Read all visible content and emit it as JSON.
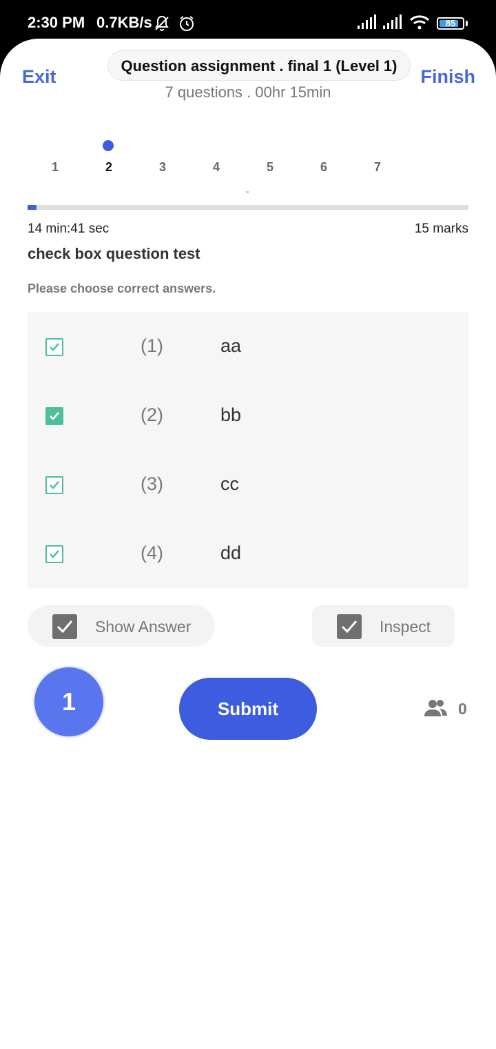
{
  "status_bar": {
    "time": "2:30 PM",
    "net_speed": "0.7KB/s",
    "battery_level": "85",
    "battery_fraction": 0.85,
    "icons": [
      "bell-muted-icon",
      "alarm-icon",
      "signal-icon",
      "signal-icon",
      "wifi-icon",
      "battery-icon"
    ]
  },
  "header": {
    "exit_label": "Exit",
    "finish_label": "Finish",
    "title": "Question assignment . final 1 (Level 1)",
    "subtitle": "7 questions . 00hr 15min"
  },
  "question_nav": {
    "numbers": [
      "1",
      "2",
      "3",
      "4",
      "5",
      "6",
      "7"
    ],
    "current": "2",
    "progress_fraction": 0.02
  },
  "question": {
    "timer": "14 min:41 sec",
    "marks": "15 marks",
    "title": "check box question test",
    "hint": "Please choose correct answers.",
    "options": [
      {
        "number": "(1)",
        "text": "aa",
        "checked": true,
        "style": "outline"
      },
      {
        "number": "(2)",
        "text": "bb",
        "checked": true,
        "style": "filled"
      },
      {
        "number": "(3)",
        "text": "cc",
        "checked": true,
        "style": "outline"
      },
      {
        "number": "(4)",
        "text": "dd",
        "checked": true,
        "style": "outline"
      }
    ]
  },
  "toggles": {
    "show_answer_label": "Show Answer",
    "show_answer_checked": true,
    "inspect_label": "Inspect",
    "inspect_checked": true
  },
  "actions": {
    "badge_number": "1",
    "submit_label": "Submit",
    "participants_count": "0"
  },
  "colors": {
    "accent": "#3e5ce0",
    "link": "#4a67d6",
    "checkbox_green": "#4fbf9a",
    "badge": "#5a76ef"
  }
}
